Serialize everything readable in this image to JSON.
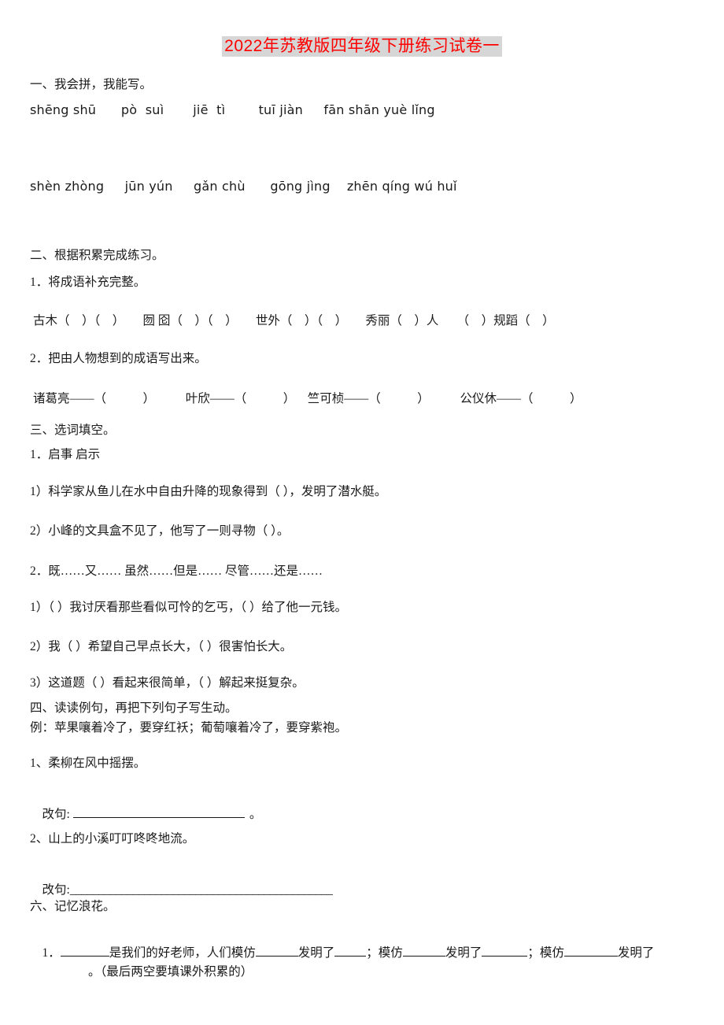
{
  "document": {
    "title": "2022年苏教版四年级下册练习试卷一",
    "title_color": "#ff0000",
    "title_highlight": "#d6d6d6"
  },
  "section_one": {
    "heading": "一、我会拼，我能写。",
    "pinyin_row_1": "shēng shū      pò  suì       jiē  tì        tuī jiàn     fān shān yuè lǐng",
    "pinyin_row_2": "shèn zhòng     jūn yún     gǎn chù      gōng jìng    zhēn qíng wú huǐ"
  },
  "section_two": {
    "heading": "二、根据积累完成练习。",
    "item_1_label": "1．将成语补充完整。",
    "item_1_line": "古木（    ）（    ）      囫 囵（    ）（    ）      世外（    ）（    ）      秀丽（    ）人      （    ）规蹈（    ）",
    "item_2_label": "2．把由人物想到的成语写出来。",
    "item_2_line": "诸葛亮——（            ）          叶欣——（            ）    竺可桢——（            ）          公仪休——（            ）"
  },
  "section_three": {
    "heading": "三、选词填空。",
    "item_1_label": "1．启事    启示",
    "item_1_q1": "1）科学家从鱼儿在水中自由升降的现象得到（      ），发明了潜水艇。",
    "item_1_q2": "2）小峰的文具盒不见了，他写了一则寻物（      ）。",
    "item_2_label": "2．既……又……    虽然……但是……    尽管……还是……",
    "item_2_q1": "1）（     ）我讨厌看那些看似可怜的乞丐，（     ）给了他一元钱。",
    "item_2_q2": "2）我（     ）希望自己早点长大，（      ）很害怕长大。",
    "item_2_q3": "3）这道题（      ）看起来很简单，（      ）解起来挺复杂。"
  },
  "section_four": {
    "heading": "四、读读例句，再把下列句子写生动。",
    "example": "例：苹果嚷着冷了，要穿红袄；葡萄嚷着冷了，要穿紫袍。",
    "item_1": "1、柔柳在风中摇摆。",
    "item_1_answer_label": "改句:",
    "item_1_answer_end": "。",
    "item_2": "2、山上的小溪叮叮咚咚地流。",
    "item_2_answer_label": "改句:",
    "item_2_answer_rule": "______________________________________________"
  },
  "section_six": {
    "heading": "六、记忆浪花。",
    "item_1_number": "1．",
    "item_1_text_a": "是我们的好老师，人们模仿",
    "item_1_text_b": "发明了",
    "item_1_text_c": "；模仿",
    "item_1_text_d": "发明了",
    "item_1_text_e": "；模仿",
    "item_1_text_f": "发明了",
    "item_1_tail": "。（最后两空要填课外积累的）"
  }
}
